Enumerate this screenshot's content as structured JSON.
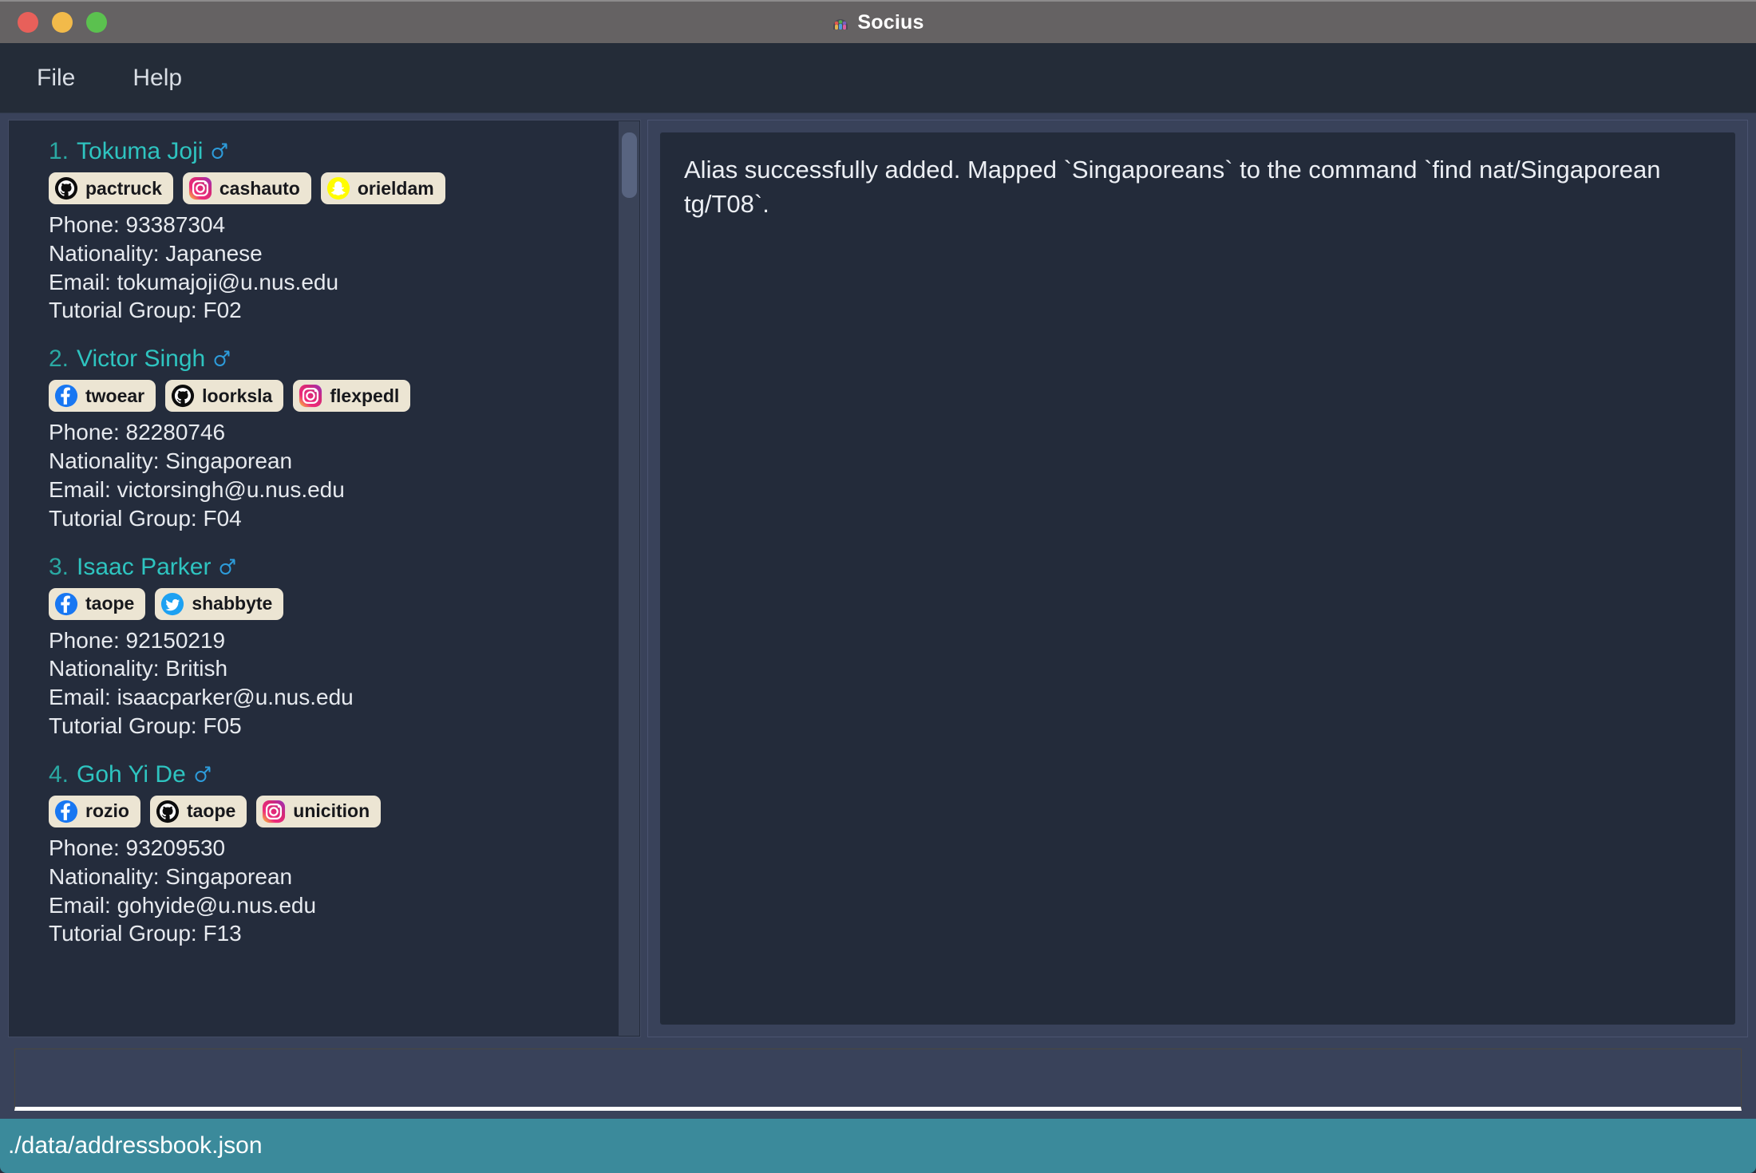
{
  "window": {
    "title": "Socius",
    "app_icon": "group-people-icon",
    "traffic_lights": {
      "close": "close-button",
      "minimize": "minimize-button",
      "maximize": "maximize-button"
    },
    "colors": {
      "titlebar_bg": "#656263",
      "close": "#e8605a",
      "minimize": "#f2ba4a",
      "maximize": "#5bc14f",
      "menubar_bg": "#242c38",
      "panel_bg": "#39425a",
      "list_bg": "#242c3c",
      "result_bg": "#232b3a",
      "accent_name": "#2ec4c0",
      "accent_index": "#2aa9a3",
      "gender_male": "#2d9cdb",
      "tag_bg": "#ece5d3",
      "statusbar_bg": "#3b8a9b"
    }
  },
  "menu": {
    "items": [
      {
        "label": "File"
      },
      {
        "label": "Help"
      }
    ]
  },
  "persons": [
    {
      "index": "1.",
      "name": "Tokuma Joji",
      "gender": "male",
      "tags": [
        {
          "platform": "github",
          "handle": "pactruck"
        },
        {
          "platform": "instagram",
          "handle": "cashauto"
        },
        {
          "platform": "snapchat",
          "handle": "orieldam"
        }
      ],
      "phone": "Phone: 93387304",
      "nationality": "Nationality: Japanese",
      "email": "Email: tokumajoji@u.nus.edu",
      "tutorial_group": "Tutorial Group: F02"
    },
    {
      "index": "2.",
      "name": "Victor Singh",
      "gender": "male",
      "tags": [
        {
          "platform": "facebook",
          "handle": "twoear"
        },
        {
          "platform": "github",
          "handle": "loorksla"
        },
        {
          "platform": "instagram",
          "handle": "flexpedl"
        }
      ],
      "phone": "Phone: 82280746",
      "nationality": "Nationality: Singaporean",
      "email": "Email: victorsingh@u.nus.edu",
      "tutorial_group": "Tutorial Group: F04"
    },
    {
      "index": "3.",
      "name": "Isaac Parker",
      "gender": "male",
      "tags": [
        {
          "platform": "facebook",
          "handle": "taope"
        },
        {
          "platform": "twitter",
          "handle": "shabbyte"
        }
      ],
      "phone": "Phone: 92150219",
      "nationality": "Nationality: British",
      "email": "Email: isaacparker@u.nus.edu",
      "tutorial_group": "Tutorial Group: F05"
    },
    {
      "index": "4.",
      "name": "Goh Yi De",
      "gender": "male",
      "tags": [
        {
          "platform": "facebook",
          "handle": "rozio"
        },
        {
          "platform": "github",
          "handle": "taope"
        },
        {
          "platform": "instagram",
          "handle": "unicition"
        }
      ],
      "phone": "Phone: 93209530",
      "nationality": "Nationality: Singaporean",
      "email": "Email: gohyide@u.nus.edu",
      "tutorial_group": "Tutorial Group: F13"
    }
  ],
  "result": {
    "text": "Alias successfully added. Mapped `Singaporeans` to the command `find nat/Singaporean tg/T08`."
  },
  "command": {
    "value": "",
    "placeholder": ""
  },
  "status": {
    "file_path": "./data/addressbook.json"
  }
}
